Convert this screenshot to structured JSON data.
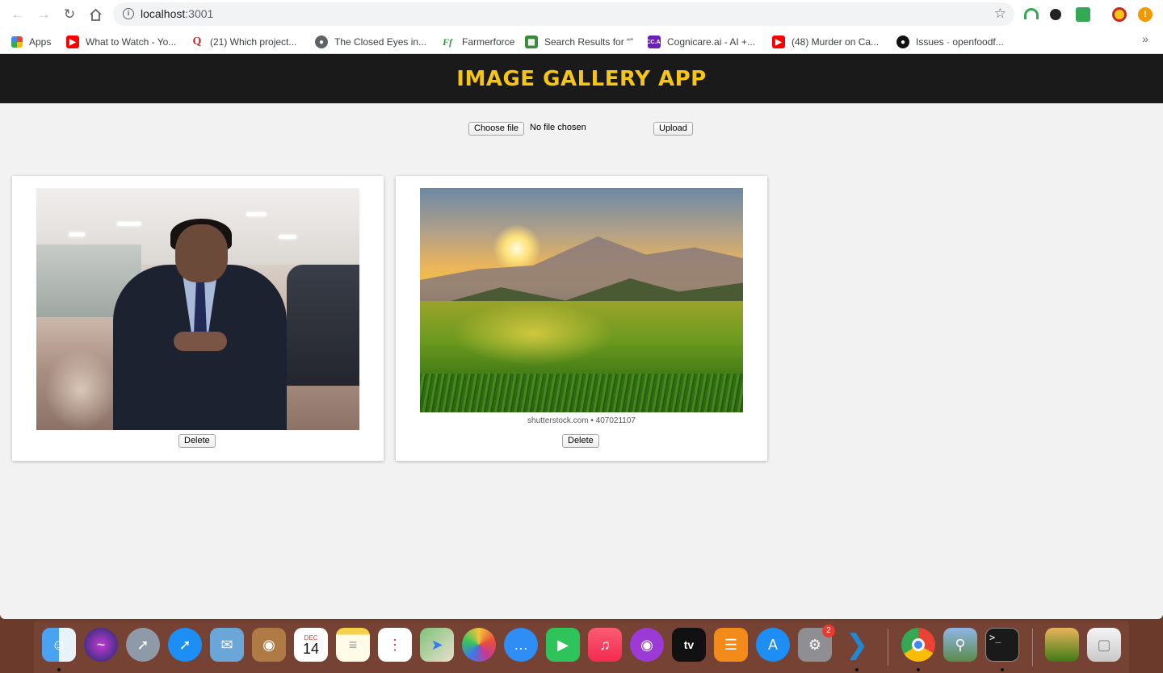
{
  "browser": {
    "url_host": "localhost",
    "url_port": ":3001",
    "bookmarks": [
      {
        "label": "Apps",
        "icon": "apps-grid-icon"
      },
      {
        "label": "What to Watch - Yo...",
        "icon": "youtube-icon"
      },
      {
        "label": "(21) Which project...",
        "icon": "quora-icon"
      },
      {
        "label": "The Closed Eyes in...",
        "icon": "globe-icon"
      },
      {
        "label": "Farmerforce",
        "icon": "farmerforce-icon"
      },
      {
        "label": "Search Results for “”",
        "icon": "search-results-icon"
      },
      {
        "label": "Cognicare.ai - AI +...",
        "icon": "cognicare-icon"
      },
      {
        "label": "(48) Murder on Ca...",
        "icon": "youtube-icon"
      },
      {
        "label": "Issues · openfoodf...",
        "icon": "github-icon"
      }
    ]
  },
  "app": {
    "title": "IMAGE GALLERY APP",
    "choose_file_label": "Choose file",
    "file_status": "No file chosen",
    "upload_label": "Upload"
  },
  "gallery": {
    "items": [
      {
        "subject": "person-in-suit-photo",
        "delete_label": "Delete"
      },
      {
        "subject": "mountain-sunset-photo",
        "watermark": "shutterstock.com • 407021107",
        "delete_label": "Delete"
      }
    ]
  },
  "dock": {
    "items": [
      {
        "name": "finder-icon"
      },
      {
        "name": "siri-icon"
      },
      {
        "name": "launchpad-icon"
      },
      {
        "name": "safari-icon"
      },
      {
        "name": "mail-icon"
      },
      {
        "name": "contacts-icon"
      },
      {
        "name": "calendar-icon",
        "month": "DEC",
        "day": "14"
      },
      {
        "name": "notes-icon"
      },
      {
        "name": "reminders-icon"
      },
      {
        "name": "maps-icon"
      },
      {
        "name": "photos-icon"
      },
      {
        "name": "messages-icon"
      },
      {
        "name": "facetime-icon"
      },
      {
        "name": "music-icon"
      },
      {
        "name": "podcasts-icon"
      },
      {
        "name": "apple-tv-icon",
        "label": "tv"
      },
      {
        "name": "books-icon"
      },
      {
        "name": "app-store-icon"
      },
      {
        "name": "system-preferences-icon",
        "badge": "2"
      },
      {
        "name": "vscode-icon"
      },
      {
        "name": "chrome-icon"
      },
      {
        "name": "preview-icon"
      },
      {
        "name": "terminal-icon",
        "label": ">_"
      },
      {
        "name": "downloads-stack-icon"
      },
      {
        "name": "trash-icon"
      }
    ]
  }
}
